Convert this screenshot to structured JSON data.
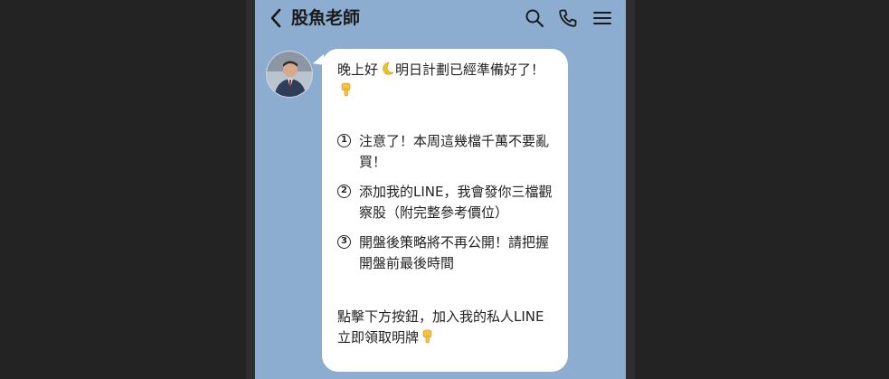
{
  "header": {
    "title": "股魚老師",
    "icons": [
      "chevron-left-icon",
      "search-icon",
      "phone-icon",
      "menu-icon"
    ]
  },
  "message": {
    "intro": "晚上好",
    "intro_rest": "明日計劃已經準備好了！",
    "items": [
      {
        "num": "1",
        "text": "注意了！本周這幾檔千萬不要亂買！"
      },
      {
        "num": "2",
        "text": "添加我的LINE，我會發你三檔觀察股（附完整參考價位）"
      },
      {
        "num": "3",
        "text": "開盤後策略將不再公開！請把握開盤前最後時間"
      }
    ],
    "closing": "點擊下方按鈕，加入我的私人LINE 立即領取明牌"
  },
  "colors": {
    "chat_background": "#8cadd0",
    "bubble": "#ffffff",
    "outer_background": "#232323"
  }
}
